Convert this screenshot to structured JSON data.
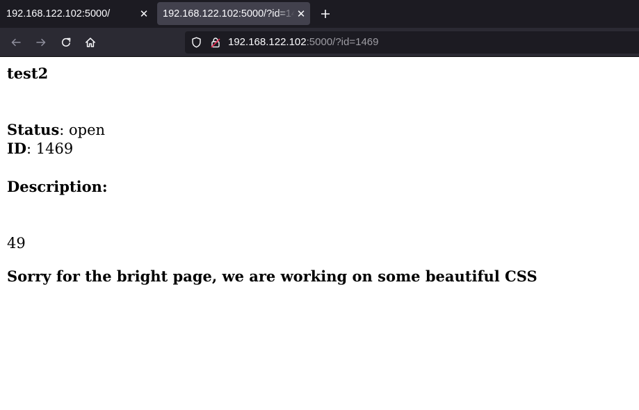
{
  "browser": {
    "tabs": [
      {
        "title": "192.168.122.102:5000/",
        "active": false
      },
      {
        "title": "192.168.122.102:5000/?id=1469",
        "active": true
      }
    ],
    "url": {
      "host": "192.168.122.102",
      "rest": ":5000/?id=1469"
    },
    "icons": {
      "back": "arrow-left-icon",
      "forward": "arrow-right-icon",
      "reload": "reload-icon",
      "home": "home-icon",
      "shield": "shield-icon",
      "lock": "lock-icon",
      "new_tab": "plus-icon",
      "close": "close-icon"
    },
    "colors": {
      "tabbar_bg": "#1c1b22",
      "active_tab_bg": "#42414d",
      "toolbar_bg": "#2b2a33",
      "url_dim": "#9d9ca3",
      "lock_accent": "#e22850"
    }
  },
  "page": {
    "title": "test2",
    "status_label": "Status",
    "status_value": ": open",
    "id_label": "ID",
    "id_value": ": 1469",
    "description_heading": "Description:",
    "description_value": "49",
    "notice": "Sorry for the bright page, we are working on some beautiful CSS"
  }
}
